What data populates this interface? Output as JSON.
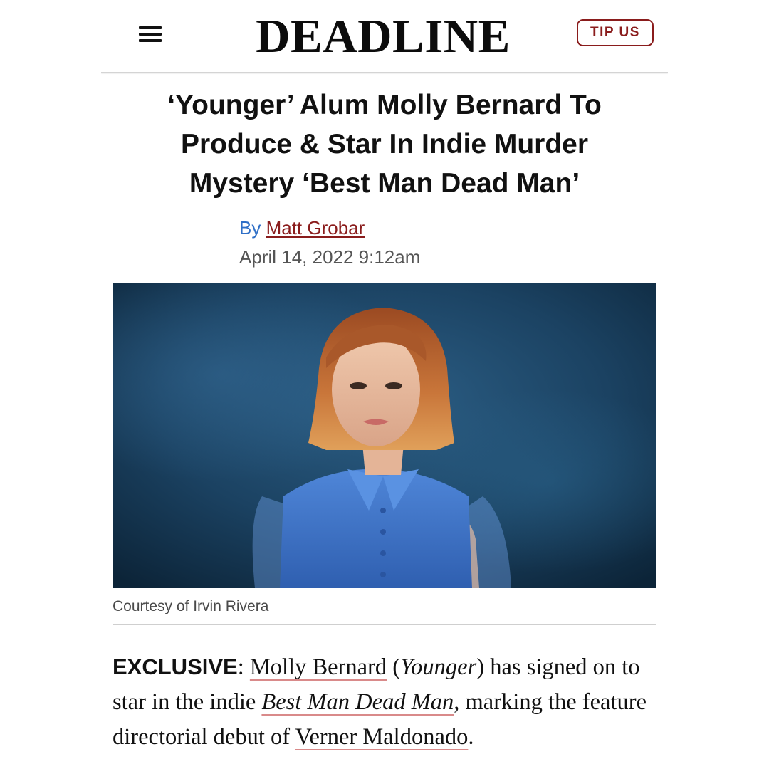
{
  "header": {
    "logo": "DEADLINE",
    "tip_button": "TIP US"
  },
  "article": {
    "headline_line1": "‘Younger’ Alum Molly Bernard To",
    "headline_line2": "Produce & Star In Indie Murder",
    "headline_line3": "Mystery ‘Best Man Dead Man’",
    "byline_prefix": "By",
    "author": "Matt Grobar",
    "date": "April 14, 2022 9:12am",
    "photo_caption": "Courtesy of Irvin Rivera",
    "body": {
      "exclusive_label": "EXCLUSIVE",
      "colon": ": ",
      "link_actor": "Molly Bernard",
      "paren_open": " (",
      "show_title": "Younger",
      "after_show": ") has signed on to star in the indie ",
      "link_film": "Best Man Dead Man",
      "after_film": ", marking the feature directorial debut of ",
      "link_director": "Verner Maldonado",
      "end": "."
    }
  },
  "colors": {
    "brand_red": "#8a1c1c",
    "byline_blue": "#2f6fc7",
    "link_underline": "#d98a8a"
  },
  "icons": {
    "menu": "hamburger-menu-icon"
  }
}
